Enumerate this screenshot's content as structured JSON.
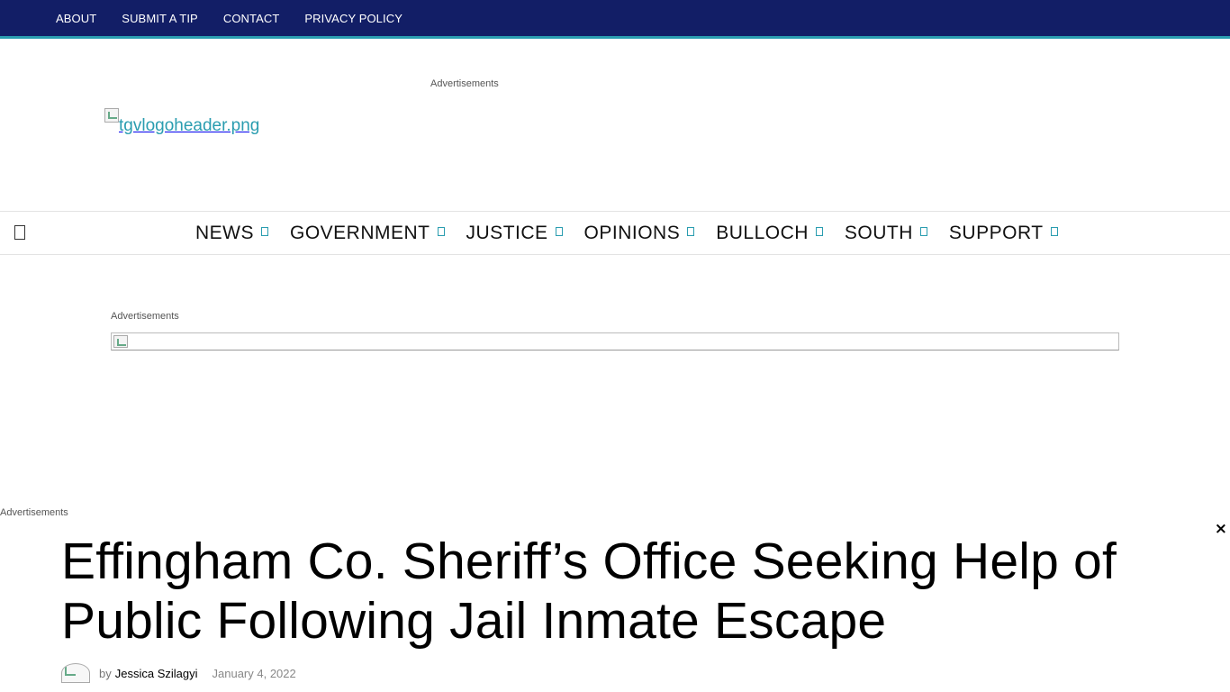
{
  "topnav": {
    "items": [
      "ABOUT",
      "SUBMIT A TIP",
      "CONTACT",
      "PRIVACY POLICY"
    ]
  },
  "header": {
    "ad_label_top": "Advertisements",
    "logo_alt": "tgvlogoheader.png"
  },
  "mainnav": {
    "menu_icon": "hamburger-icon",
    "items": [
      {
        "label": "NEWS",
        "icon": "chevron-down-icon"
      },
      {
        "label": "GOVERNMENT",
        "icon": "chevron-down-icon"
      },
      {
        "label": "JUSTICE",
        "icon": "chevron-down-icon"
      },
      {
        "label": "OPINIONS",
        "icon": "chevron-down-icon"
      },
      {
        "label": "BULLOCH",
        "icon": "chevron-down-icon"
      },
      {
        "label": "SOUTH",
        "icon": "chevron-down-icon"
      },
      {
        "label": "SUPPORT",
        "icon": "chevron-down-icon"
      }
    ]
  },
  "ads": {
    "label_middle": "Advertisements",
    "label_bottom": "Advertisements"
  },
  "close": {
    "label": "×"
  },
  "article": {
    "title": "Effingham Co. Sheriff’s Office Seeking Help of Public Following Jail Inmate Escape",
    "by": "by",
    "author": "Jessica Szilagyi",
    "date": "January 4, 2022"
  },
  "colors": {
    "topbar": "#121e66",
    "accent": "#2a9db0"
  }
}
